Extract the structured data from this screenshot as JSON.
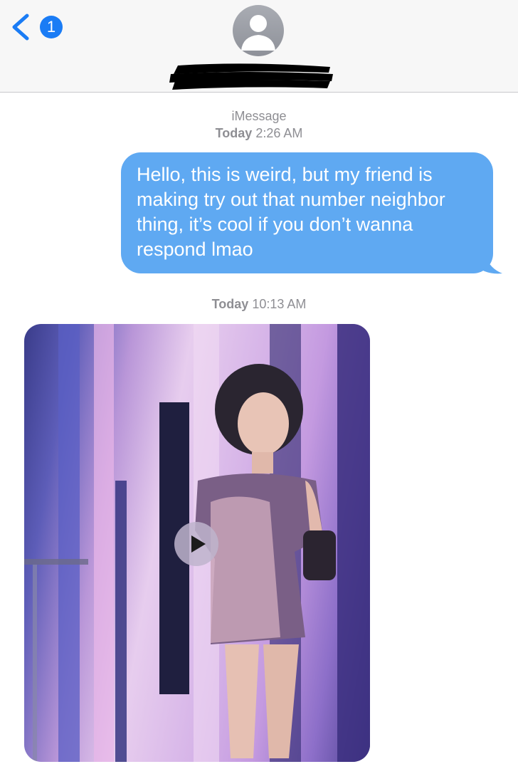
{
  "header": {
    "back_badge_count": "1",
    "contact_name": "",
    "accent_color": "#1a7cf5"
  },
  "conversation": {
    "first_service_label": "iMessage",
    "first_timestamp_day": "Today",
    "first_timestamp_time": "2:26 AM",
    "outgoing_message": "Hello, this is weird, but my friend is making try out that number neighbor thing, it’s cool if you don’t wanna respond lmao",
    "outgoing_bubble_color": "#5fa9f2",
    "second_timestamp_day": "Today",
    "second_timestamp_time": "10:13 AM",
    "incoming_attachment": {
      "type": "video",
      "play_icon": "play-icon"
    }
  }
}
